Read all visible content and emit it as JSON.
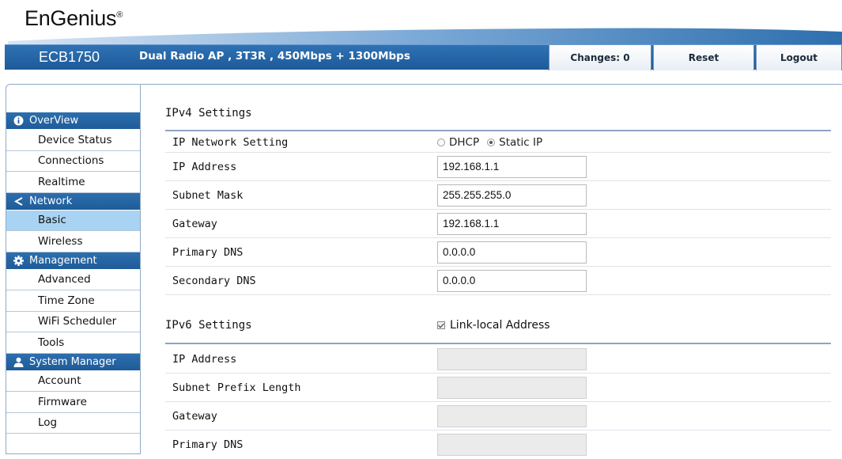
{
  "header": {
    "logo_text": "EnGenius",
    "logo_reg": "®",
    "model": "ECB1750",
    "description": "Dual Radio AP , 3T3R , 450Mbps + 1300Mbps",
    "changes_label": "Changes: 0",
    "reset_label": "Reset",
    "logout_label": "Logout"
  },
  "sidebar": {
    "sections": [
      {
        "title": "OverView",
        "icon": "info-icon",
        "items": [
          "Device Status",
          "Connections",
          "Realtime"
        ]
      },
      {
        "title": "Network",
        "icon": "share-icon",
        "items": [
          "Basic",
          "Wireless"
        ]
      },
      {
        "title": "Management",
        "icon": "gear-icon",
        "items": [
          "Advanced",
          "Time Zone",
          "WiFi Scheduler",
          "Tools"
        ]
      },
      {
        "title": "System Manager",
        "icon": "user-icon",
        "items": [
          "Account",
          "Firmware",
          "Log"
        ]
      }
    ],
    "active_item": "Basic"
  },
  "ipv4": {
    "title": "IPv4 Settings",
    "network_setting_label": "IP Network Setting",
    "dhcp_label": "DHCP",
    "static_label": "Static IP",
    "selected_mode": "Static IP",
    "ip_address_label": "IP Address",
    "ip_address": "192.168.1.1",
    "subnet_mask_label": "Subnet Mask",
    "subnet_mask": "255.255.255.0",
    "gateway_label": "Gateway",
    "gateway": "192.168.1.1",
    "primary_dns_label": "Primary DNS",
    "primary_dns": "0.0.0.0",
    "secondary_dns_label": "Secondary DNS",
    "secondary_dns": "0.0.0.0"
  },
  "ipv6": {
    "title": "IPv6 Settings",
    "link_local_label": "Link-local Address",
    "link_local_checked": true,
    "ip_address_label": "IP Address",
    "ip_address": "",
    "prefix_length_label": "Subnet Prefix Length",
    "prefix_length": "",
    "gateway_label": "Gateway",
    "gateway": "",
    "primary_dns_label": "Primary DNS",
    "primary_dns": ""
  },
  "colors": {
    "header_blue": "#1f5c99",
    "active_item": "#a9d3f2"
  }
}
